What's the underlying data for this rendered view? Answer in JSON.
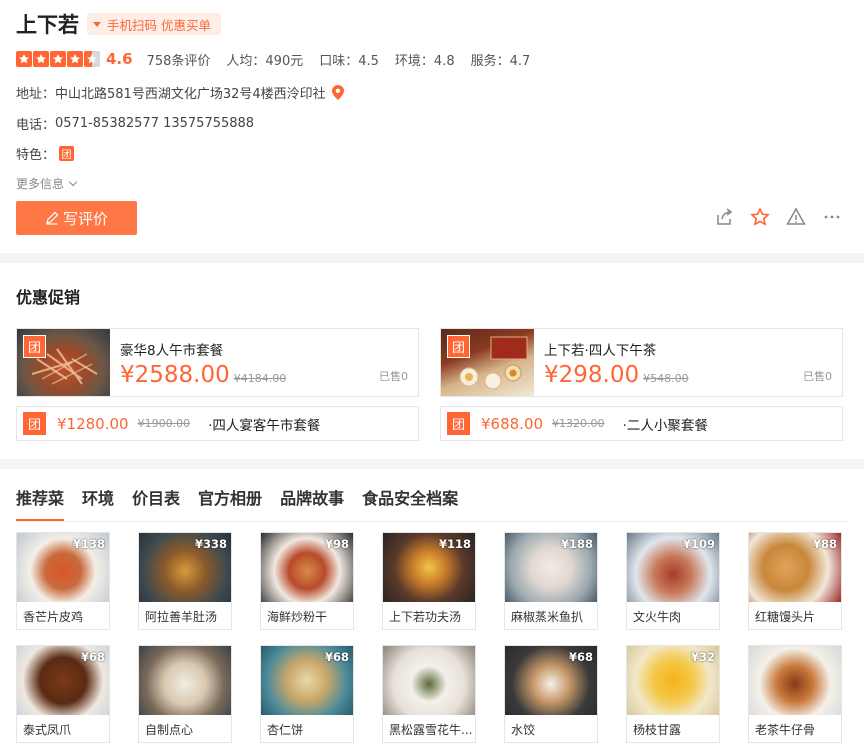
{
  "shop": {
    "name": "上下若",
    "scan_tag": "手机扫码 优惠买单",
    "score": "4.6",
    "reviews": "758条评价",
    "avg": "人均：490元",
    "taste": "口味：4.5",
    "env": "环境：4.8",
    "service": "服务：4.7",
    "stars": 4.5,
    "address_label": "地址：",
    "address": "中山北路581号西湖文化广场32号4楼西泠印社",
    "phone_label": "电话：",
    "phone": "0571-85382577 13575755888",
    "feature_label": "特色：",
    "feature_badge": "团",
    "more_info": "更多信息",
    "write_review": "写评价"
  },
  "colors": {
    "accent": "#ff6633",
    "button": "#ff7744"
  },
  "promo": {
    "title": "优惠促销",
    "badge": "团",
    "big_deals": [
      {
        "name": "豪华8人午市套餐",
        "price": "¥2588.00",
        "old": "¥4184.00",
        "sold": "已售0"
      },
      {
        "name": "上下若·四人下午茶",
        "price": "¥298.00",
        "old": "¥548.00",
        "sold": "已售0"
      }
    ],
    "small_deals": [
      {
        "price": "¥1280.00",
        "old": "¥1900.00",
        "name": "·四人宴客午市套餐"
      },
      {
        "price": "¥688.00",
        "old": "¥1320.00",
        "name": "·二人小聚套餐"
      }
    ]
  },
  "tabs": [
    "推荐菜",
    "环境",
    "价目表",
    "官方相册",
    "品牌故事",
    "食品安全档案"
  ],
  "dishes": [
    {
      "name": "香芒片皮鸡",
      "price": "¥138"
    },
    {
      "name": "阿拉善羊肚汤",
      "price": "¥338"
    },
    {
      "name": "海鲜炒粉干",
      "price": "¥98"
    },
    {
      "name": "上下若功夫汤",
      "price": "¥118"
    },
    {
      "name": "麻椒蒸米鱼扒",
      "price": "¥188"
    },
    {
      "name": "文火牛肉",
      "price": "¥109"
    },
    {
      "name": "红糖馒头片",
      "price": "¥88"
    },
    {
      "name": "泰式凤爪",
      "price": "¥68"
    },
    {
      "name": "自制点心",
      "price": ""
    },
    {
      "name": "杏仁饼",
      "price": "¥68"
    },
    {
      "name": "黑松露雪花牛...",
      "price": ""
    },
    {
      "name": "水饺",
      "price": "¥68"
    },
    {
      "name": "杨枝甘露",
      "price": "¥32"
    },
    {
      "name": "老茶牛仔骨",
      "price": ""
    }
  ]
}
